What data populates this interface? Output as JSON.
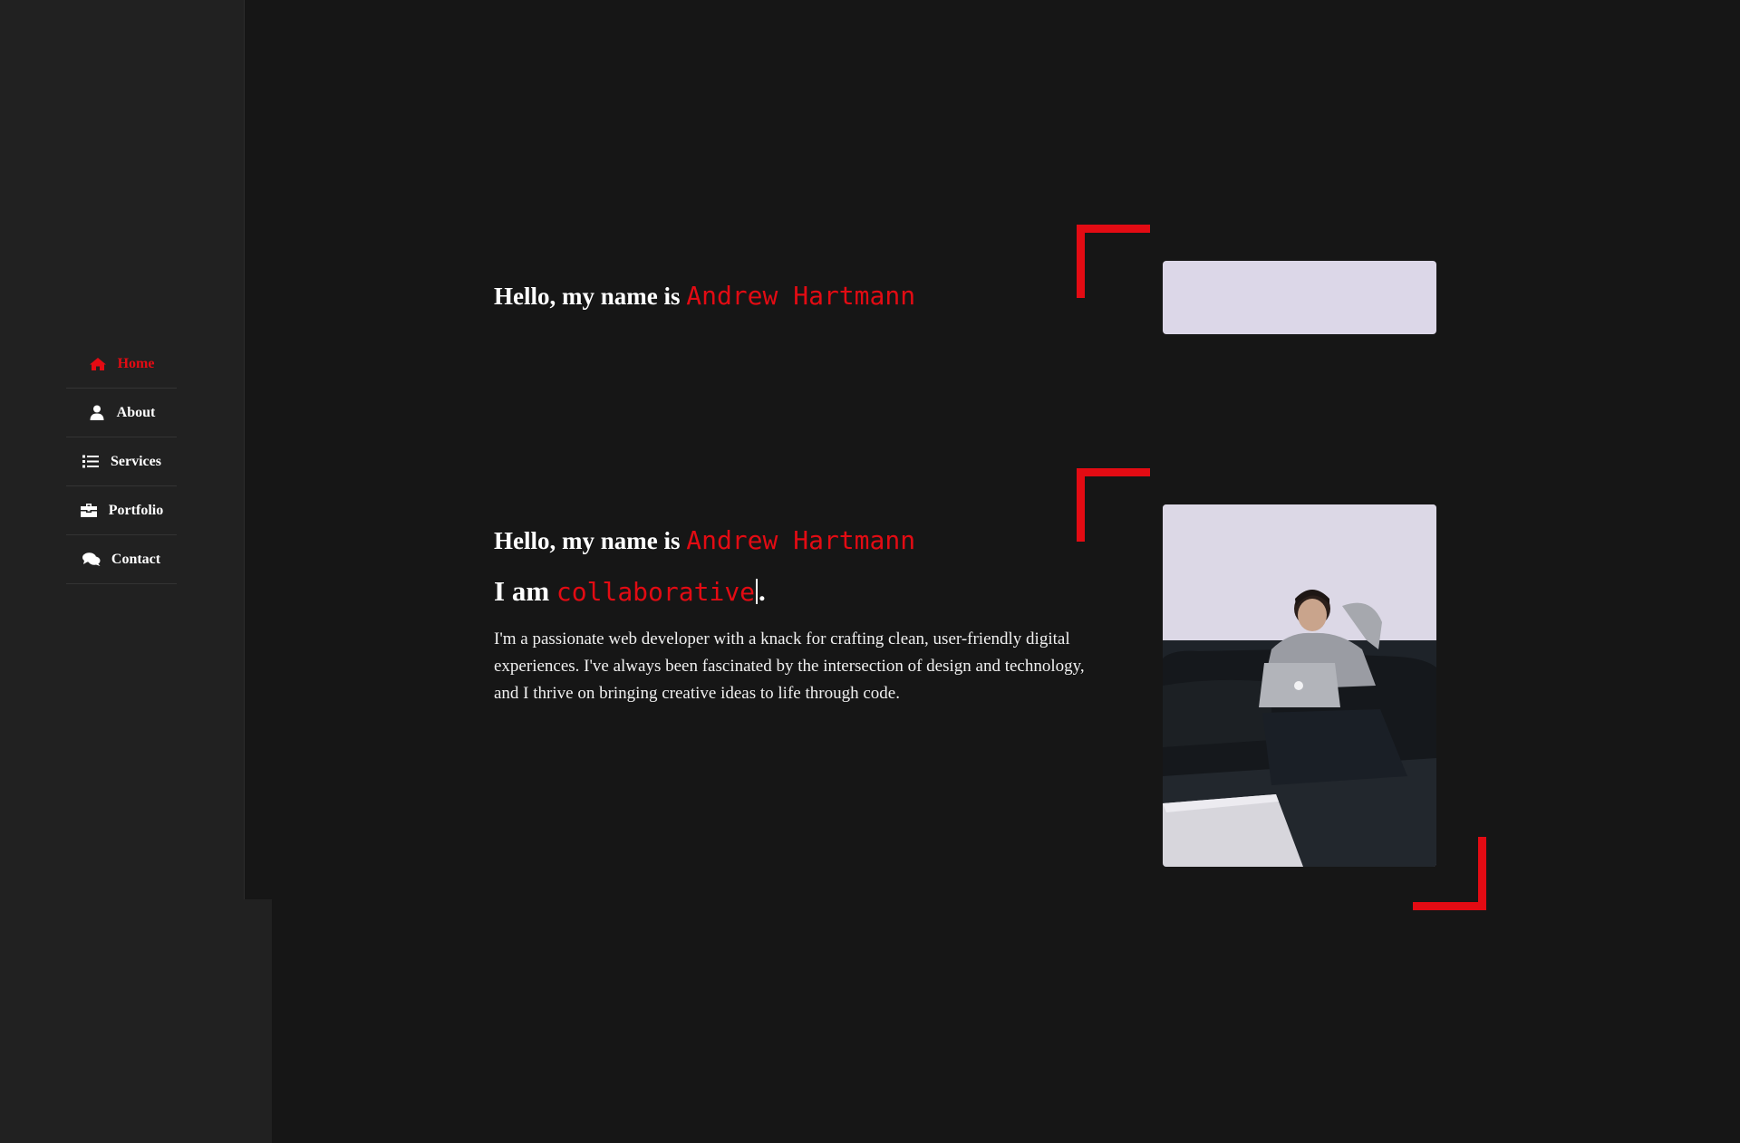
{
  "sidebar": {
    "items": [
      {
        "label": "Home",
        "icon": "home-icon",
        "active": true
      },
      {
        "label": "About",
        "icon": "user-icon",
        "active": false
      },
      {
        "label": "Services",
        "icon": "list-icon",
        "active": false
      },
      {
        "label": "Portfolio",
        "icon": "briefcase-icon",
        "active": false
      },
      {
        "label": "Contact",
        "icon": "chat-icon",
        "active": false
      }
    ]
  },
  "hero_preview": {
    "greeting_prefix": "Hello, my name is ",
    "name": "Andrew Hartmann"
  },
  "hero": {
    "greeting_prefix": "Hello, my name is ",
    "name": "Andrew Hartmann",
    "role_prefix": "I am ",
    "role_word": "collaborative",
    "role_suffix": ".",
    "bio": "I'm a passionate web developer with a knack for crafting clean, user-friendly digital experiences. I've always been fascinated by the intersection of design and technology, and I thrive on bringing creative ideas to life through code."
  },
  "colors": {
    "accent": "#e30b13",
    "background": "#161616",
    "sidebar": "#212121"
  }
}
